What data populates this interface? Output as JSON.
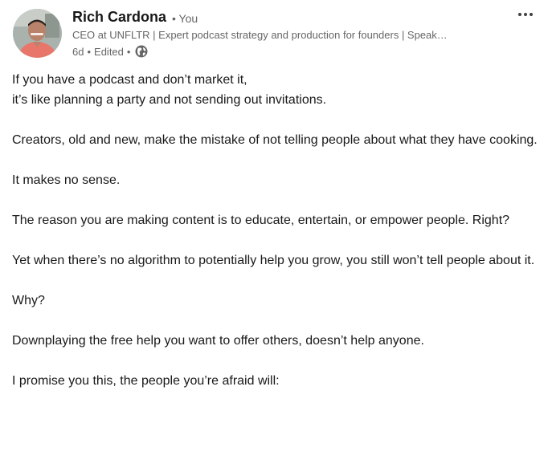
{
  "author": {
    "name": "Rich Cardona",
    "badge": "• You",
    "headline": "CEO at UNFLTR | Expert podcast strategy and production for founders | Speak…",
    "avatar_icon": "profile-photo"
  },
  "meta": {
    "time": "6d",
    "sep1": "•",
    "edited": "Edited",
    "sep2": "•",
    "visibility_icon": "globe-icon"
  },
  "actions": {
    "more_icon": "more-horizontal-icon"
  },
  "post": {
    "paragraphs": [
      "If you have a podcast and don’t market it,\nit’s like planning a party and not sending out invitations.",
      "Creators, old and new, make the mistake of not telling people about what they have cooking.",
      "It makes no sense.",
      "The reason you are making content is to educate, entertain, or empower people. Right?",
      "Yet when there’s no algorithm to potentially help you grow, you still won’t tell people about it.",
      "Why?",
      "Downplaying the free help you want to offer others, doesn’t help anyone.",
      "I promise you this, the people you’re afraid will:"
    ]
  },
  "colors": {
    "text_primary": "#191919",
    "text_secondary": "#666666",
    "background": "#ffffff"
  }
}
